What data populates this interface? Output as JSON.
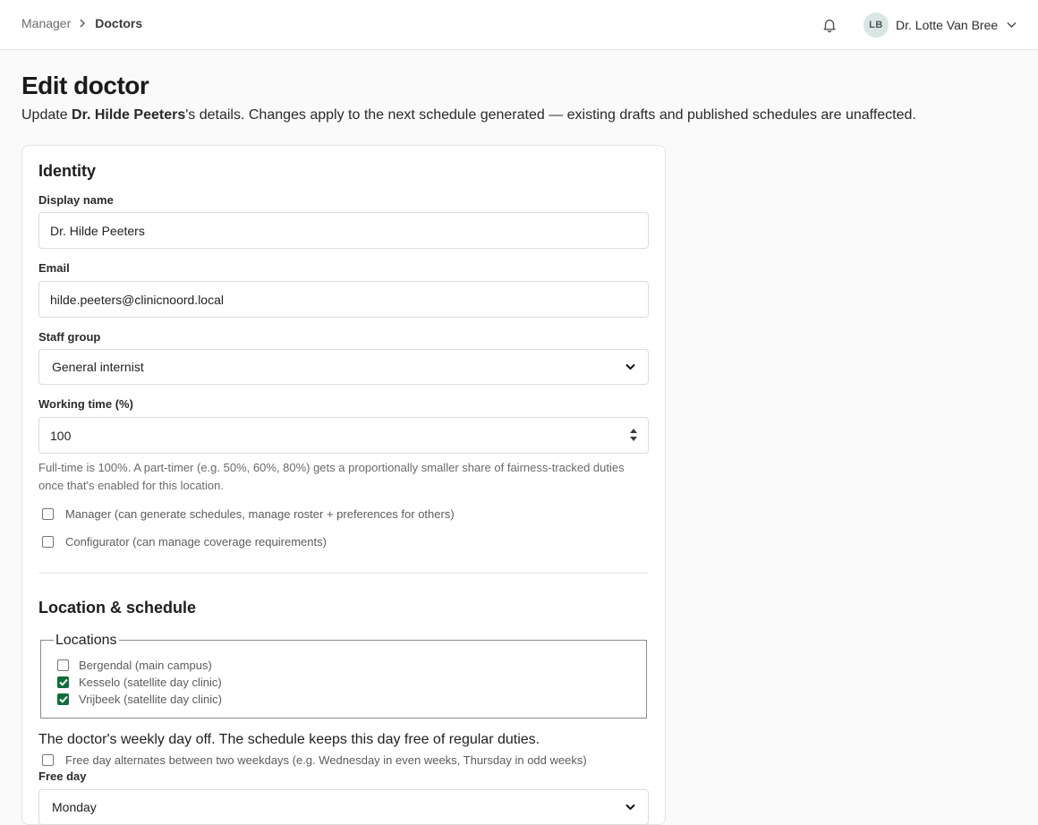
{
  "breadcrumb": {
    "parent": "Manager",
    "current": "Doctors"
  },
  "user": {
    "initials": "LB",
    "name": "Dr. Lotte Van Bree"
  },
  "page": {
    "title": "Edit doctor",
    "subtitle_prefix": "Update ",
    "subtitle_name": "Dr. Hilde Peeters",
    "subtitle_suffix": "'s details. Changes apply to the next schedule generated — existing drafts and published schedules are unaffected."
  },
  "identity": {
    "section_title": "Identity",
    "display_name_label": "Display name",
    "display_name_value": "Dr. Hilde Peeters",
    "email_label": "Email",
    "email_value": "hilde.peeters@clinicnoord.local",
    "staff_group_label": "Staff group",
    "staff_group_value": "General internist",
    "working_time_label": "Working time (%)",
    "working_time_value": "100",
    "working_time_help": "Full-time is 100%. A part-timer (e.g. 50%, 60%, 80%) gets a proportionally smaller share of fairness-tracked duties once that's enabled for this location.",
    "manager_label": "Manager (can generate schedules, manage roster + preferences for others)",
    "manager_checked": false,
    "configurator_label": "Configurator (can manage coverage requirements)",
    "configurator_checked": false
  },
  "location_schedule": {
    "section_title": "Location & schedule",
    "locations_legend": "Locations",
    "locations": [
      {
        "label": "Bergendal (main campus)",
        "checked": false
      },
      {
        "label": "Kesselo (satellite day clinic)",
        "checked": true
      },
      {
        "label": "Vrijbeek (satellite day clinic)",
        "checked": true
      }
    ],
    "day_off_description": "The doctor's weekly day off. The schedule keeps this day free of regular duties.",
    "alternate_label": "Free day alternates between two weekdays (e.g. Wednesday in even weeks, Thursday in odd weeks)",
    "alternate_checked": false,
    "free_day_label": "Free day",
    "free_day_value": "Monday"
  },
  "colors": {
    "accent_check": "#0f6e3a",
    "border": "#dcdcdc",
    "muted_text": "#6a6a6a"
  },
  "icons": [
    "chevron-right-icon",
    "bell-icon",
    "chevron-down-icon",
    "spinner-arrows-icon",
    "checkmark-icon"
  ]
}
